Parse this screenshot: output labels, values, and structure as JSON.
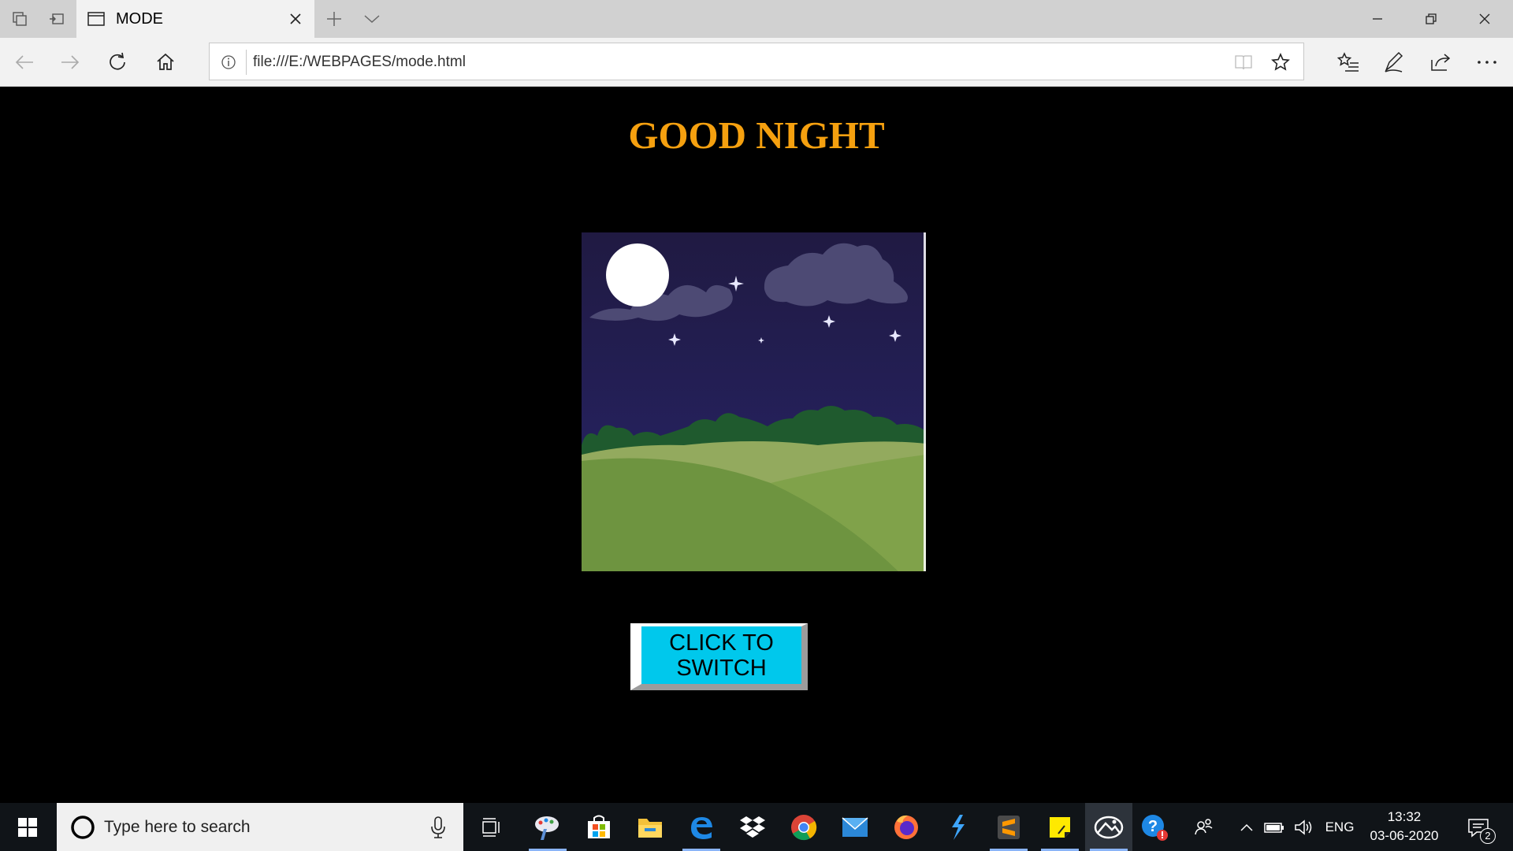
{
  "browser": {
    "tab": {
      "title": "MODE"
    },
    "address": {
      "url": "file:///E:/WEBPAGES/mode.html"
    }
  },
  "page": {
    "heading": "GOOD NIGHT",
    "image_description_icon": "night-landscape-image",
    "switch_button": {
      "line1": "CLICK TO",
      "line2": "SWITCH"
    }
  },
  "taskbar": {
    "search": {
      "placeholder": "Type here to search"
    },
    "apps": [
      "task-view",
      "paint",
      "store",
      "file-explorer",
      "edge",
      "dropbox",
      "chrome",
      "mail",
      "firefox",
      "vscode",
      "sublime-text",
      "sticky-notes",
      "photos",
      "get-help"
    ],
    "tray": {
      "language": "ENG"
    },
    "clock": {
      "time": "13:32",
      "date": "03-06-2020"
    },
    "notifications": {
      "count": "2"
    }
  },
  "colors": {
    "heading": "#f5a00f",
    "button": "#00c8ec",
    "page_bg": "#000000"
  }
}
